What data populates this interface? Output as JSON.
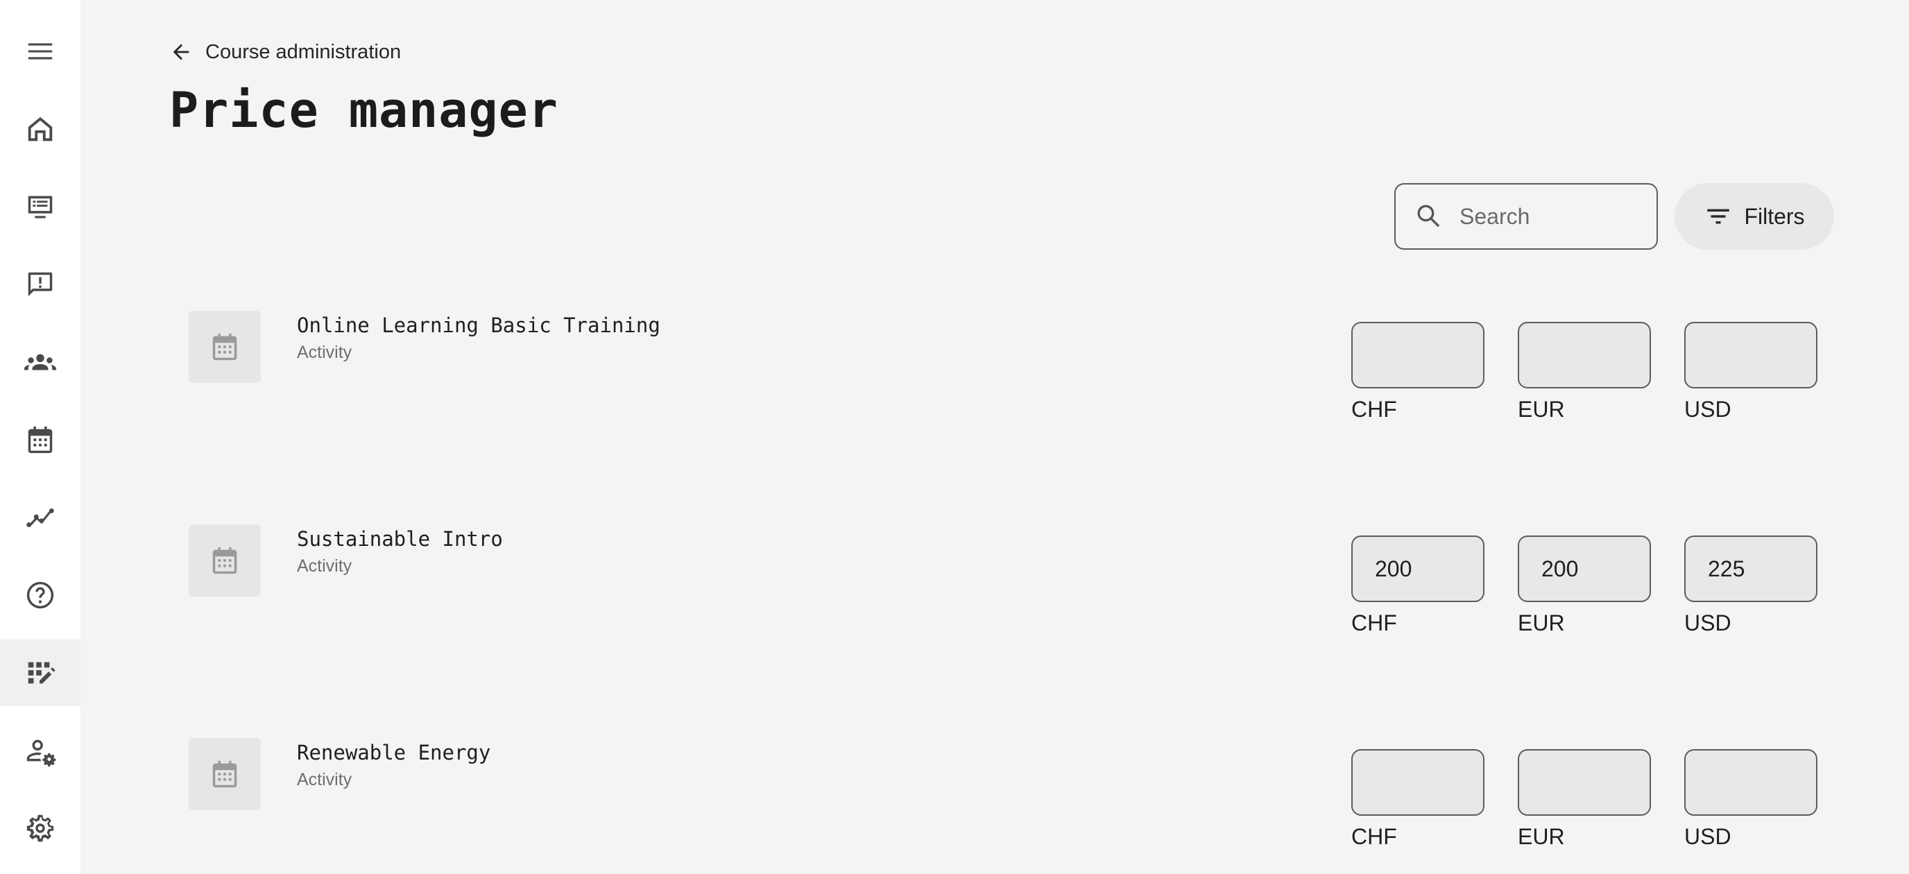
{
  "sidebar": {
    "items": [
      {
        "name": "menu-icon"
      },
      {
        "name": "home-icon"
      },
      {
        "name": "courses-icon"
      },
      {
        "name": "feedback-icon"
      },
      {
        "name": "groups-icon"
      },
      {
        "name": "calendar-icon"
      },
      {
        "name": "analytics-icon"
      },
      {
        "name": "help-icon"
      },
      {
        "name": "price-manager-icon",
        "active": true
      },
      {
        "name": "user-settings-icon"
      },
      {
        "name": "settings-icon"
      }
    ]
  },
  "header": {
    "back_label": "Course administration",
    "title": "Price manager"
  },
  "toolbar": {
    "search_placeholder": "Search",
    "search_value": "",
    "filters_label": "Filters"
  },
  "currencies": [
    "CHF",
    "EUR",
    "USD"
  ],
  "rows": [
    {
      "title": "Online Learning Basic Training",
      "type": "Activity",
      "prices": {
        "CHF": "",
        "EUR": "",
        "USD": ""
      }
    },
    {
      "title": "Sustainable Intro",
      "type": "Activity",
      "prices": {
        "CHF": "200",
        "EUR": "200",
        "USD": "225"
      }
    },
    {
      "title": "Renewable Energy",
      "type": "Activity",
      "prices": {
        "CHF": "",
        "EUR": "",
        "USD": ""
      }
    }
  ]
}
